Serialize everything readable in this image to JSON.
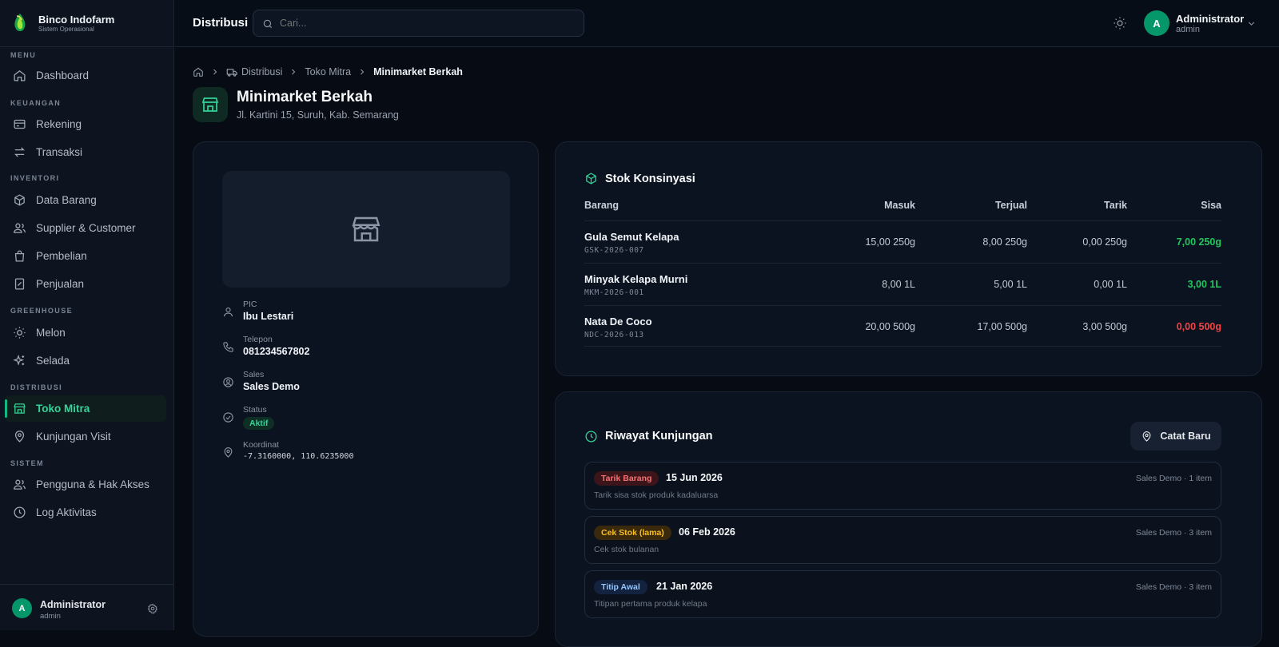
{
  "app": {
    "name": "Binco Indofarm",
    "subtitle": "Sistem Operasional"
  },
  "sidebar": {
    "sections": {
      "menu": "MENU",
      "keuangan": "KEUANGAN",
      "inventori": "INVENTORI",
      "greenhouse": "GREENHOUSE",
      "distribusi": "DISTRIBUSI",
      "sistem": "SISTEM"
    },
    "items": {
      "dashboard": "Dashboard",
      "rekening": "Rekening",
      "transaksi": "Transaksi",
      "data_barang": "Data Barang",
      "supplier": "Supplier & Customer",
      "pembelian": "Pembelian",
      "penjualan": "Penjualan",
      "melon": "Melon",
      "selada": "Selada",
      "toko_mitra": "Toko Mitra",
      "kunjungan": "Kunjungan Visit",
      "pengguna": "Pengguna & Hak Akses",
      "log": "Log Aktivitas"
    },
    "active": "toko_mitra",
    "user": {
      "initial": "A",
      "name": "Administrator",
      "role": "admin"
    }
  },
  "topbar": {
    "title": "Distribusi",
    "search_placeholder": "Cari...",
    "user": {
      "initial": "A",
      "name": "Administrator",
      "role": "admin"
    }
  },
  "breadcrumb": {
    "distribusi": "Distribusi",
    "toko_mitra": "Toko Mitra",
    "current": "Minimarket Berkah"
  },
  "store": {
    "name": "Minimarket Berkah",
    "address": "Jl. Kartini 15, Suruh, Kab. Semarang",
    "pic_label": "PIC",
    "pic": "Ibu Lestari",
    "phone_label": "Telepon",
    "phone": "081234567802",
    "sales_label": "Sales",
    "sales": "Sales Demo",
    "status_label": "Status",
    "status": "Aktif",
    "coord_label": "Koordinat",
    "coord": "-7.3160000, 110.6235000"
  },
  "stock": {
    "title": "Stok Konsinyasi",
    "columns": {
      "barang": "Barang",
      "masuk": "Masuk",
      "terjual": "Terjual",
      "tarik": "Tarik",
      "sisa": "Sisa"
    },
    "rows": [
      {
        "name": "Gula Semut Kelapa",
        "code": "GSK-2026-007",
        "masuk": "15,00 250g",
        "terjual": "8,00 250g",
        "tarik": "0,00 250g",
        "sisa": "7,00 250g",
        "sisa_color": "#22c55e"
      },
      {
        "name": "Minyak Kelapa Murni",
        "code": "MKM-2026-001",
        "masuk": "8,00 1L",
        "terjual": "5,00 1L",
        "tarik": "0,00 1L",
        "sisa": "3,00 1L",
        "sisa_color": "#22c55e"
      },
      {
        "name": "Nata De Coco",
        "code": "NDC-2026-013",
        "masuk": "20,00 500g",
        "terjual": "17,00 500g",
        "tarik": "3,00 500g",
        "sisa": "0,00 500g",
        "sisa_color": "#ef4444"
      }
    ]
  },
  "visits": {
    "title": "Riwayat Kunjungan",
    "new_button": "Catat Baru",
    "items": [
      {
        "tag": "Tarik Barang",
        "tag_bg": "#3b1519",
        "tag_fg": "#f87171",
        "date": "15 Jun 2026",
        "note": "Tarik sisa stok produk kadaluarsa",
        "meta": "Sales Demo · 1 item"
      },
      {
        "tag": "Cek Stok (lama)",
        "tag_bg": "#3a2a0b",
        "tag_fg": "#fbbf24",
        "date": "06 Feb 2026",
        "note": "Cek stok bulanan",
        "meta": "Sales Demo · 3 item"
      },
      {
        "tag": "Titip Awal",
        "tag_bg": "#13233f",
        "tag_fg": "#93c5fd",
        "date": "21 Jan 2026",
        "note": "Titipan pertama produk kelapa",
        "meta": "Sales Demo · 3 item"
      }
    ]
  }
}
